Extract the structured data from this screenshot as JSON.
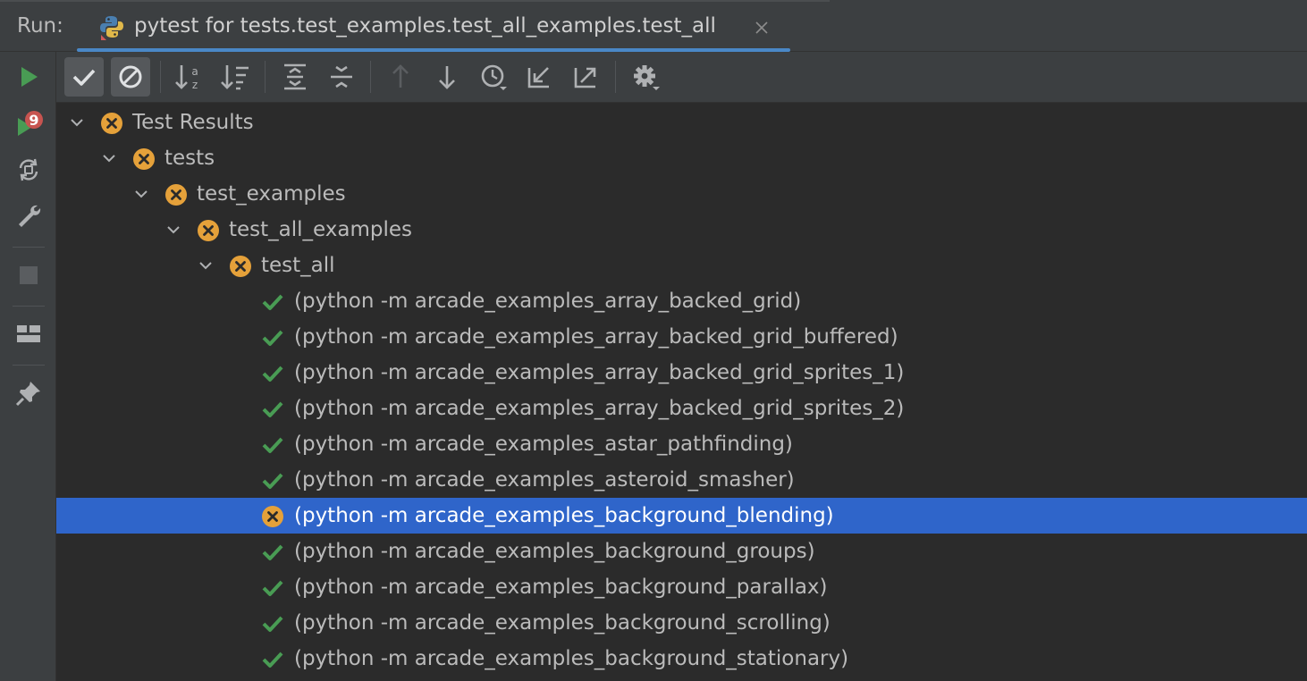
{
  "run_panel": {
    "label": "Run:",
    "tab": {
      "title": "pytest for tests.test_examples.test_all_examples.test_all",
      "icon": "python-icon",
      "close_icon": "close-icon",
      "accent_color": "#4a88c7"
    }
  },
  "sidebar": {
    "items": [
      {
        "name": "rerun-icon",
        "color": "#499c54"
      },
      {
        "name": "rerun-failed-icon",
        "badge": "9",
        "color": "#499c54",
        "badge_color": "#c75450"
      },
      {
        "name": "toggle-auto-test-icon"
      },
      {
        "name": "wrench-icon"
      },
      {
        "name": "stop-icon",
        "disabled": true
      },
      {
        "name": "layout-icon"
      },
      {
        "name": "pin-icon"
      }
    ]
  },
  "toolbar": {
    "items": [
      {
        "name": "show-passed-icon",
        "toggled": true
      },
      {
        "name": "show-ignored-icon",
        "toggled": true
      },
      {
        "name": "sort-alphabetically-icon"
      },
      {
        "name": "sort-by-duration-icon"
      },
      {
        "name": "expand-all-icon"
      },
      {
        "name": "collapse-all-icon"
      },
      {
        "name": "previous-failed-icon",
        "disabled": true
      },
      {
        "name": "next-failed-icon"
      },
      {
        "name": "test-history-icon"
      },
      {
        "name": "import-tests-icon"
      },
      {
        "name": "export-tests-icon"
      },
      {
        "name": "settings-icon"
      }
    ]
  },
  "tree": {
    "colors": {
      "failed": "#e5a13a",
      "passed": "#499c54",
      "selection": "#2f65ca"
    },
    "rows": [
      {
        "label": "Test Results",
        "depth": 0,
        "status": "failed",
        "expanded": true
      },
      {
        "label": "tests",
        "depth": 1,
        "status": "failed",
        "expanded": true
      },
      {
        "label": "test_examples",
        "depth": 2,
        "status": "failed",
        "expanded": true
      },
      {
        "label": "test_all_examples",
        "depth": 3,
        "status": "failed",
        "expanded": true
      },
      {
        "label": "test_all",
        "depth": 4,
        "status": "failed",
        "expanded": true
      },
      {
        "label": "(python -m arcade_examples_array_backed_grid)",
        "depth": 5,
        "status": "passed"
      },
      {
        "label": "(python -m arcade_examples_array_backed_grid_buffered)",
        "depth": 5,
        "status": "passed"
      },
      {
        "label": "(python -m arcade_examples_array_backed_grid_sprites_1)",
        "depth": 5,
        "status": "passed"
      },
      {
        "label": "(python -m arcade_examples_array_backed_grid_sprites_2)",
        "depth": 5,
        "status": "passed"
      },
      {
        "label": "(python -m arcade_examples_astar_pathfinding)",
        "depth": 5,
        "status": "passed"
      },
      {
        "label": "(python -m arcade_examples_asteroid_smasher)",
        "depth": 5,
        "status": "passed"
      },
      {
        "label": "(python -m arcade_examples_background_blending)",
        "depth": 5,
        "status": "failed",
        "selected": true
      },
      {
        "label": "(python -m arcade_examples_background_groups)",
        "depth": 5,
        "status": "passed"
      },
      {
        "label": "(python -m arcade_examples_background_parallax)",
        "depth": 5,
        "status": "passed"
      },
      {
        "label": "(python -m arcade_examples_background_scrolling)",
        "depth": 5,
        "status": "passed"
      },
      {
        "label": "(python -m arcade_examples_background_stationary)",
        "depth": 5,
        "status": "passed"
      }
    ]
  }
}
